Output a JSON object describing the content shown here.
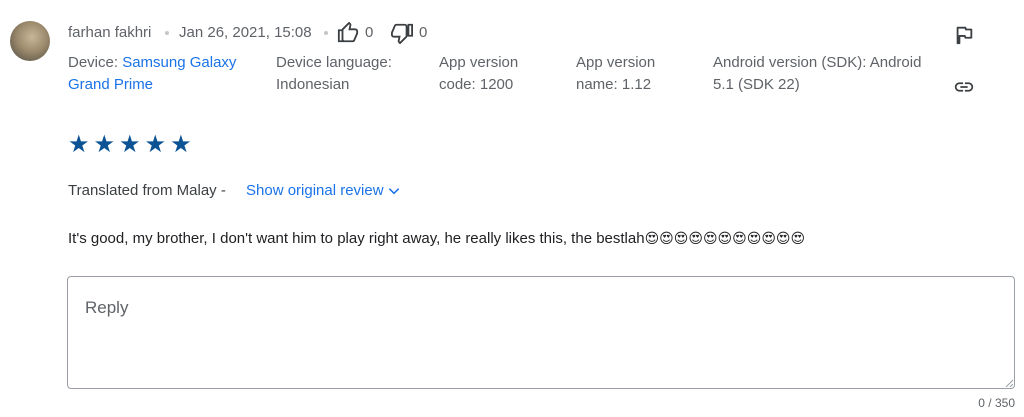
{
  "review": {
    "author": "farhan fakhri",
    "date": "Jan 26, 2021, 15:08",
    "thumbs_up_count": "0",
    "thumbs_down_count": "0",
    "device_label": "Device:",
    "device_value": "Samsung Galaxy Grand Prime",
    "device_value_line1": "Samsung Galaxy",
    "device_value_line2": "Grand Prime",
    "language_label": "Device language:",
    "language_value": "Indonesian",
    "app_version_code_label": "App version",
    "app_version_code_value": "code: 1200",
    "app_version_name_label": "App version",
    "app_version_name_value": "name: 1.12",
    "android_version_line1": "Android version (SDK): Android",
    "android_version_line2": "5.1 (SDK 22)",
    "rating": 5,
    "rating_max": 5,
    "translated_from": "Translated from Malay -",
    "show_original_label": "Show original review",
    "text": "It's good, my brother, I don't want him to play right away, he really likes this, the bestlah",
    "emoji_count": 11
  },
  "reply": {
    "placeholder": "Reply",
    "value": "",
    "char_count": "0 / 350"
  },
  "icons": {
    "thumbs_up": "thumbs-up-icon",
    "thumbs_down": "thumbs-down-icon",
    "flag": "flag-icon",
    "link": "link-icon",
    "chevron": "chevron-down-icon",
    "star": "star-icon",
    "emoji": "heart-eyes-emoji-icon"
  },
  "colors": {
    "link": "#1a73e8",
    "star": "#0b5394",
    "text": "#3c4043",
    "muted": "#5f6368"
  }
}
